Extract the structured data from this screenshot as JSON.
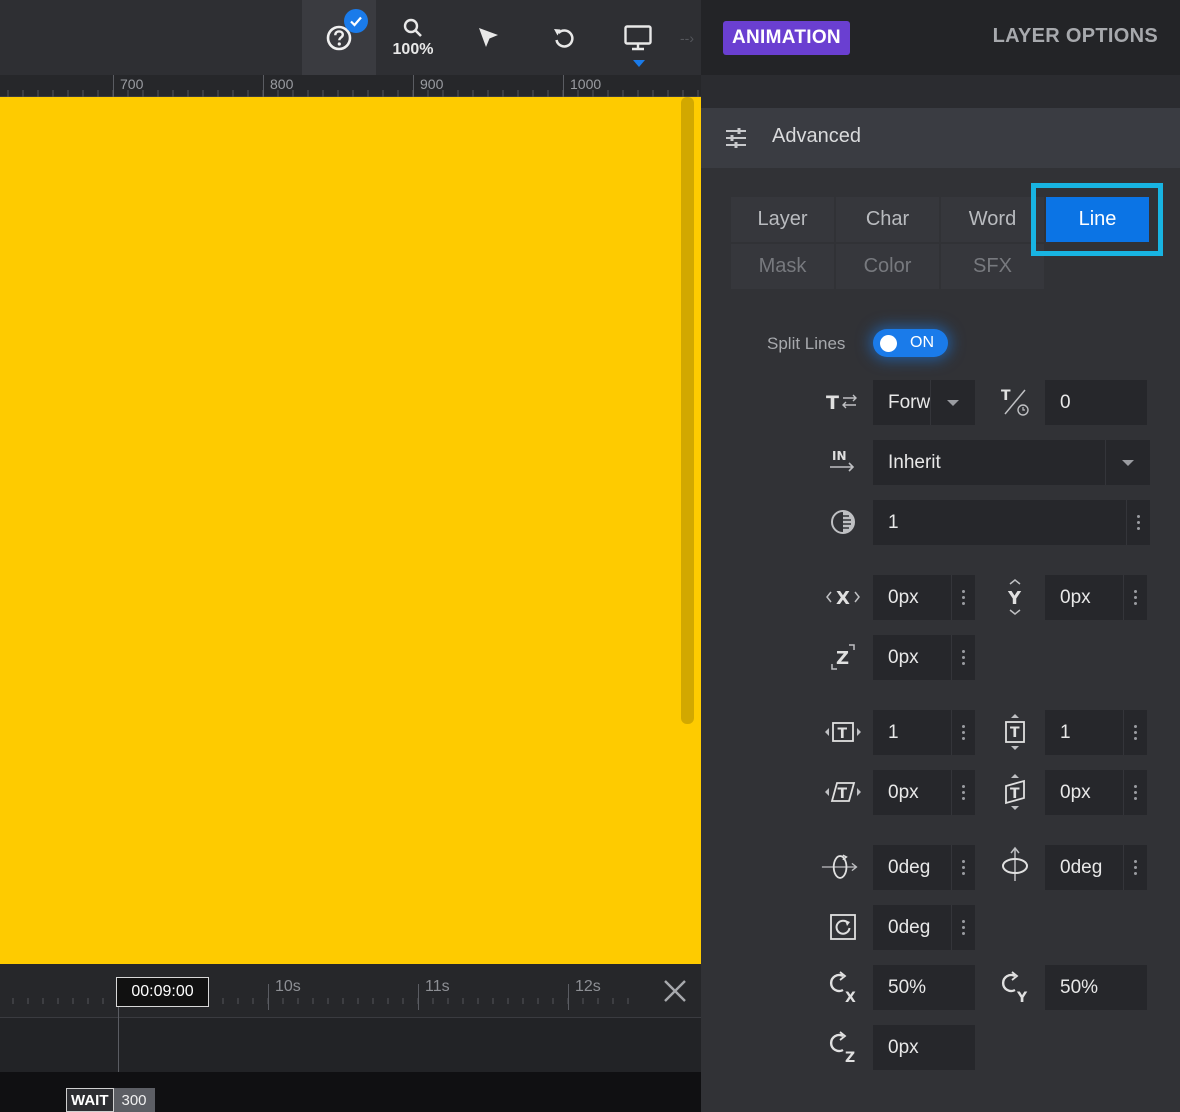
{
  "toolbar": {
    "zoom": "100%",
    "icons": [
      "help-icon",
      "check-icon",
      "zoom-icon",
      "pointer-icon",
      "undo-icon",
      "monitor-icon"
    ]
  },
  "ruler": {
    "marks": [
      "700",
      "800",
      "900",
      "1000"
    ]
  },
  "timeline": {
    "timecode": "00:09:00",
    "marks": [
      "10s",
      "11s",
      "12s"
    ],
    "wait_label": "WAIT",
    "wait_value": "300"
  },
  "panel": {
    "tab_animation": "ANIMATION",
    "tab_layer_options": "LAYER OPTIONS",
    "section_title": "Advanced",
    "split_tabs": [
      "Layer",
      "Char",
      "Word",
      "Line",
      "Mask",
      "Color",
      "SFX"
    ],
    "active_split_tab": "Line",
    "split_lines_label": "Split Lines",
    "split_lines_toggle": "ON",
    "direction_value": "Forw",
    "delay_value": "0",
    "in_value": "Inherit",
    "opacity_value": "1",
    "x_value": "0px",
    "y_value": "0px",
    "z_value": "0px",
    "scale_x_value": "1",
    "scale_y_value": "1",
    "skew_x_value": "0px",
    "skew_y_value": "0px",
    "rotate_x_value": "0deg",
    "rotate_y_value": "0deg",
    "rotate_z_value": "0deg",
    "origin_x_value": "50%",
    "origin_y_value": "50%",
    "origin_z_value": "0px"
  },
  "colors": {
    "canvas": "#fecb00",
    "accent_blue": "#0b74e5",
    "animation_tab": "#6a3fd1",
    "highlight": "#18b4e2"
  }
}
